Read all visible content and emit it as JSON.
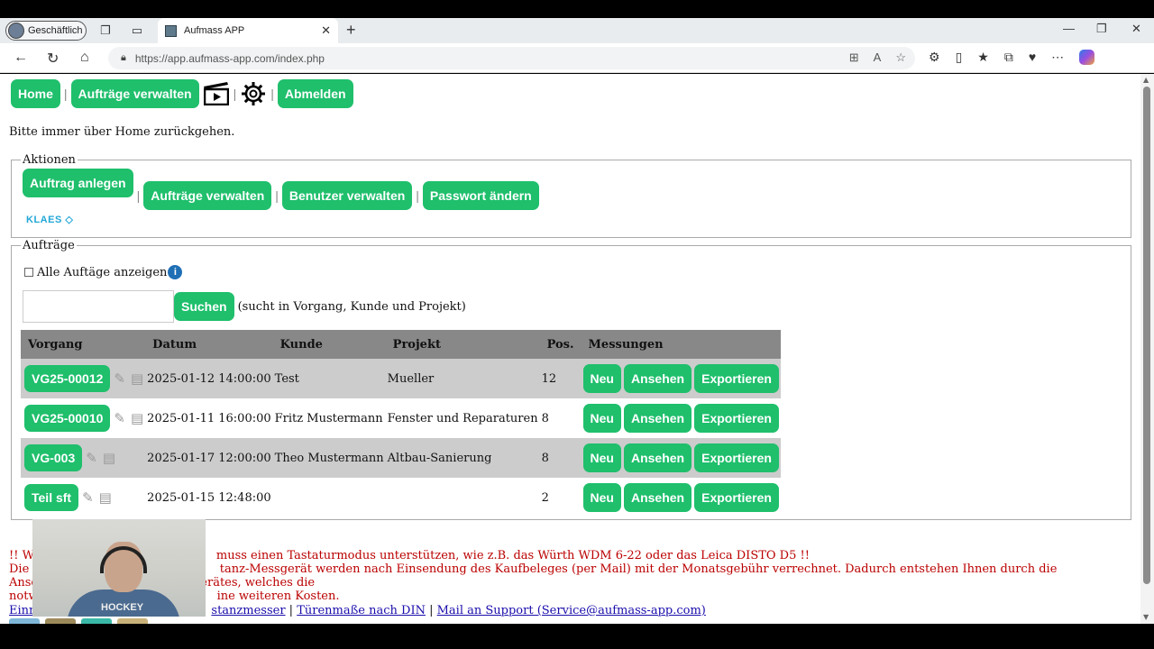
{
  "browser": {
    "profile_label": "Geschäftlich",
    "tab_title": "Aufmass APP",
    "url": "https://app.aufmass-app.com/index.php"
  },
  "menu": {
    "home": "Home",
    "auftraege": "Aufträge verwalten",
    "abmelden": "Abmelden"
  },
  "hint": "Bitte immer über Home zurückgehen.",
  "aktionen": {
    "legend": "Aktionen",
    "auftrag_anlegen": "Auftrag anlegen",
    "auftraege_verwalten": "Aufträge verwalten",
    "benutzer_verwalten": "Benutzer verwalten",
    "passwort_aendern": "Passwort ändern",
    "klaes_logo": "KLAES"
  },
  "auftraege": {
    "legend": "Aufträge",
    "show_all_label": "Alle Auftäge anzeigen",
    "search_button": "Suchen",
    "search_note": "(sucht in Vorgang, Kunde und Projekt)",
    "search_value": "",
    "columns": {
      "vorgang": "Vorgang",
      "datum": "Datum",
      "kunde": "Kunde",
      "projekt": "Projekt",
      "pos": "Pos.",
      "messungen": "Messungen"
    },
    "rows": [
      {
        "vorgang": "VG25-00012",
        "datum": "2025-01-12 14:00:00",
        "kunde": "Test",
        "projekt": "Mueller",
        "pos": "12"
      },
      {
        "vorgang": "VG25-00010",
        "datum": "2025-01-11 16:00:00",
        "kunde": "Fritz Mustermann",
        "projekt": "Fenster und Reparaturen",
        "pos": "8"
      },
      {
        "vorgang": "VG-003",
        "datum": "2025-01-17 12:00:00",
        "kunde": "Theo Mustermann",
        "projekt": "Altbau-Sanierung",
        "pos": "8"
      },
      {
        "vorgang": "Teil sft",
        "datum": "2025-01-15 12:48:00",
        "kunde": "",
        "projekt": "",
        "pos": "2"
      }
    ],
    "btn_neu": "Neu",
    "btn_ansehen": "Ansehen",
    "btn_exportieren": "Exportieren"
  },
  "warning": {
    "line1": "!! Wi",
    "line1b": "muss einen Tastaturmodus unterstützen, wie z.B. das Würth WDM 6-22 oder das Leica DISTO D5 !!",
    "line2a": "Die A",
    "line2b": "tanz-Messgerät werden nach Einsendung des Kaufbeleges (per Mail) mit der Monatsgebühr verrechnet. Dadurch entstehen Ihnen durch die Anschaffung eines neuen Messgerätes, welches die",
    "line3a": "notw",
    "line3b": "ine weiteren Kosten."
  },
  "footer_links": {
    "l1": "Einri",
    "l2": "stanzmesser",
    "l3": "Türenmaße nach DIN",
    "l4": "Mail an Support (Service@aufmass-app.com)"
  },
  "webcam": {
    "shirt_text": "HOCKEY"
  },
  "colors": {
    "accent": "#1fbf6c",
    "header_gray": "#888888",
    "row_gray": "#cccccc",
    "warning": "#bb0000"
  }
}
